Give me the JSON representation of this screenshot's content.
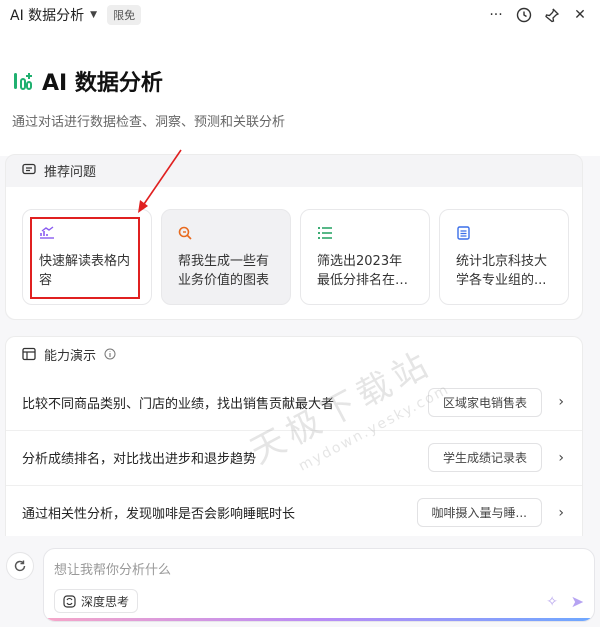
{
  "header": {
    "title": "AI 数据分析",
    "badge": "限免",
    "actions": [
      "more-icon",
      "history-icon",
      "pin-icon",
      "close-icon"
    ]
  },
  "hero": {
    "headline": "AI 数据分析",
    "subtitle": "通过对话进行数据检查、洞察、预测和关联分析"
  },
  "recommend": {
    "title": "推荐问题",
    "cards": [
      {
        "icon": "chart-trend-icon",
        "text": "快速解读表格内容"
      },
      {
        "icon": "chart-search-icon",
        "text": "帮我生成一些有业务价值的图表"
      },
      {
        "icon": "list-icon",
        "text": "筛选出2023年最低分排名在前..."
      },
      {
        "icon": "table-icon",
        "text": "统计北京科技大学各专业组的..."
      }
    ]
  },
  "demo": {
    "title": "能力演示",
    "info_icon": "info-icon",
    "rows": [
      {
        "text": "比较不同商品类别、门店的业绩，找出销售贡献最大者",
        "tag": "区域家电销售表"
      },
      {
        "text": "分析成绩排名，对比找出进步和退步趋势",
        "tag": "学生成绩记录表"
      },
      {
        "text": "通过相关性分析，发现咖啡是否会影响睡眠时长",
        "tag": "咖啡摄入量与睡..."
      }
    ]
  },
  "composer": {
    "placeholder": "想让我帮你分析什么",
    "deep_think": "深度思考"
  },
  "watermark": {
    "main": "天极下载站",
    "url": "mydown.yesky.com"
  },
  "colors": {
    "highlight": "#e02020",
    "accent": "#8a5cf0"
  }
}
